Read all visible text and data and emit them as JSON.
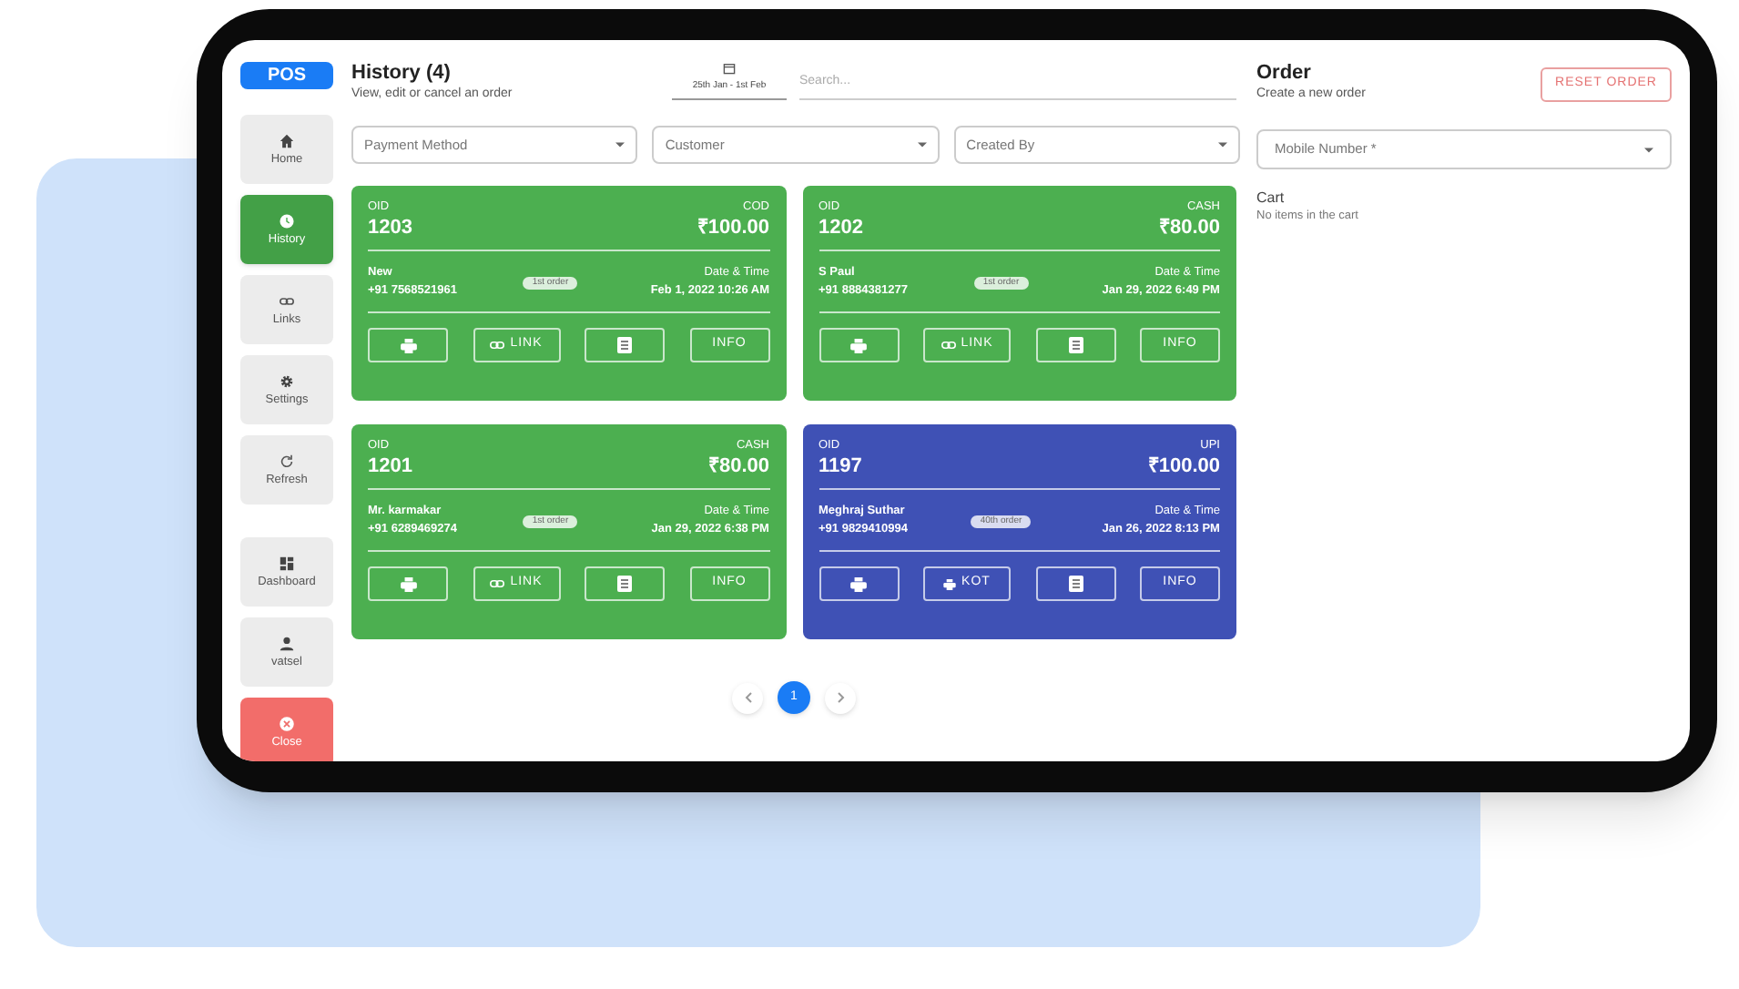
{
  "sidebar": {
    "items": [
      {
        "kind": "brand",
        "label": "POS"
      },
      {
        "kind": "nav",
        "label": "Home",
        "selected": false
      },
      {
        "kind": "nav",
        "label": "History",
        "selected": true
      },
      {
        "kind": "nav",
        "label": "Links",
        "selected": false
      },
      {
        "kind": "nav",
        "label": "Settings",
        "selected": false
      },
      {
        "kind": "nav",
        "label": "Refresh",
        "selected": false
      },
      {
        "kind": "divider"
      },
      {
        "kind": "nav",
        "label": "Dashboard",
        "selected": false
      },
      {
        "kind": "nav",
        "label": "vatsel",
        "selected": false
      },
      {
        "kind": "danger",
        "label": "Close"
      }
    ]
  },
  "history": {
    "title": "History (4)",
    "subtitle": "View, edit or cancel an order",
    "date_range": "25th Jan - 1st Feb",
    "search": {
      "placeholder": "Search..."
    },
    "filters": [
      {
        "placeholder": "Payment Method"
      },
      {
        "placeholder": "Customer"
      },
      {
        "placeholder": "Created By"
      }
    ],
    "orders": [
      {
        "oid_label": "OID",
        "oid": "1203",
        "payment": "COD",
        "amount": "₹100.00",
        "customer": "New",
        "phone": "+91 7568521961",
        "badge": "1st order",
        "date_label": "Date & Time",
        "date": "Feb 1, 2022 10:26 AM",
        "color": "#4caf50",
        "second_action": {
          "kind": "link",
          "label": "LINK"
        },
        "info": "INFO"
      },
      {
        "oid_label": "OID",
        "oid": "1202",
        "payment": "CASH",
        "amount": "₹80.00",
        "customer": "S Paul",
        "phone": "+91 8884381277",
        "badge": "1st order",
        "date_label": "Date & Time",
        "date": "Jan 29, 2022 6:49 PM",
        "color": "#4caf50",
        "second_action": {
          "kind": "link",
          "label": "LINK"
        },
        "info": "INFO"
      },
      {
        "oid_label": "OID",
        "oid": "1201",
        "payment": "CASH",
        "amount": "₹80.00",
        "customer": "Mr. karmakar",
        "phone": "+91 6289469274",
        "badge": "1st order",
        "date_label": "Date & Time",
        "date": "Jan 29, 2022 6:38 PM",
        "color": "#4caf50",
        "second_action": {
          "kind": "link",
          "label": "LINK"
        },
        "info": "INFO"
      },
      {
        "oid_label": "OID",
        "oid": "1197",
        "payment": "UPI",
        "amount": "₹100.00",
        "customer": "Meghraj Suthar",
        "phone": "+91 9829410994",
        "badge": "40th order",
        "date_label": "Date & Time",
        "date": "Jan 26, 2022 8:13 PM",
        "color": "#3f51b5",
        "second_action": {
          "kind": "kot",
          "label": "KOT"
        },
        "info": "INFO"
      }
    ],
    "pagination": {
      "pages": [
        {
          "label": "1",
          "selected": true
        }
      ]
    }
  },
  "order": {
    "title": "Order",
    "subtitle": "Create a new order",
    "reset_button": "RESET ORDER",
    "mobile_field": {
      "placeholder": "Mobile Number *"
    },
    "cart_title": "Cart",
    "cart_empty": "No items in the cart"
  }
}
